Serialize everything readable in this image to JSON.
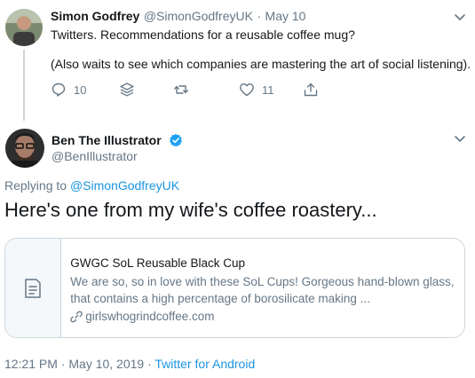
{
  "parent_tweet": {
    "author_name": "Simon Godfrey",
    "handle": "@SimonGodfreyUK",
    "separator": "·",
    "date": "May 10",
    "text_line1": "Twitters. Recommendations for a reusable coffee mug?",
    "text_line2": "(Also waits to see which companies are mastering the art of social listening).",
    "reply_count": "10",
    "like_count": "11"
  },
  "main_tweet": {
    "author_name": "Ben The Illustrator",
    "handle": "@BenIllustrator",
    "replying_prefix": "Replying to",
    "replying_to": "@SimonGodfreyUK",
    "text": "Here's one from my wife's coffee roastery...",
    "card": {
      "title": "GWGC SoL Reusable Black Cup",
      "description": "We are so, so in love with these SoL Cups! Gorgeous hand-blown glass, that contains a high percentage of borosilicate making ...",
      "domain": "girlswhogrindcoffee.com"
    },
    "timestamp": "12:21 PM · May 10, 2019",
    "separator": "·",
    "source": "Twitter for Android"
  },
  "colors": {
    "accent": "#1b95e0",
    "muted": "#657786",
    "border": "#ccd6dd",
    "verified": "#1da1f2"
  },
  "icons": [
    "chevron-down-icon",
    "reply-icon",
    "stack-icon",
    "retweet-icon",
    "heart-icon",
    "share-icon",
    "verified-icon",
    "document-icon",
    "link-icon"
  ]
}
